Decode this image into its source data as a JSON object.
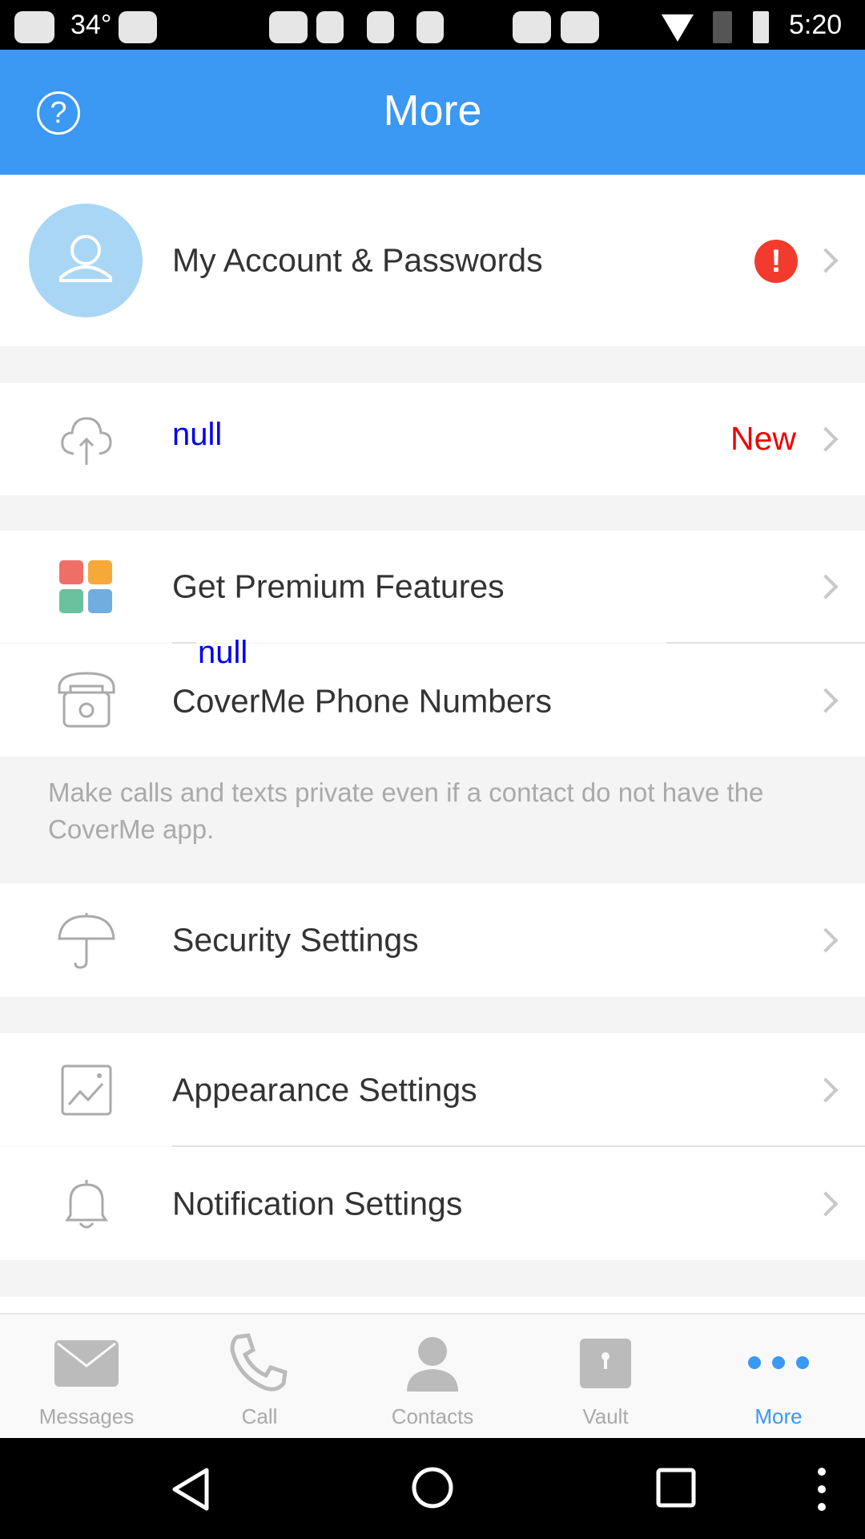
{
  "status_bar": {
    "temperature": "34°",
    "time": "5:20"
  },
  "header": {
    "title": "More",
    "help_icon": "question-circle-icon"
  },
  "account": {
    "label": "My Account & Passwords",
    "alert_icon": "exclamation-badge-icon",
    "alert_color": "#f23b2e"
  },
  "backup": {
    "label": "null",
    "badge": "New",
    "label_color": "#0000ee",
    "badge_color": "#ee0000"
  },
  "premium": {
    "label": "Get Premium Features",
    "overlay_label": "null"
  },
  "phone_numbers": {
    "label": "CoverMe Phone Numbers"
  },
  "description": "Make calls and texts private even if a contact do not have the CoverMe app.",
  "security": {
    "label": "Security Settings"
  },
  "appearance": {
    "label": "Appearance Settings"
  },
  "notification": {
    "label": "Notification Settings"
  },
  "tabs": [
    {
      "label": "Messages",
      "icon": "envelope-icon",
      "active": false
    },
    {
      "label": "Call",
      "icon": "phone-icon",
      "active": false
    },
    {
      "label": "Contacts",
      "icon": "person-icon",
      "active": false
    },
    {
      "label": "Vault",
      "icon": "vault-icon",
      "active": false
    },
    {
      "label": "More",
      "icon": "dots-icon",
      "active": true
    }
  ],
  "accent_color": "#3b98f3"
}
